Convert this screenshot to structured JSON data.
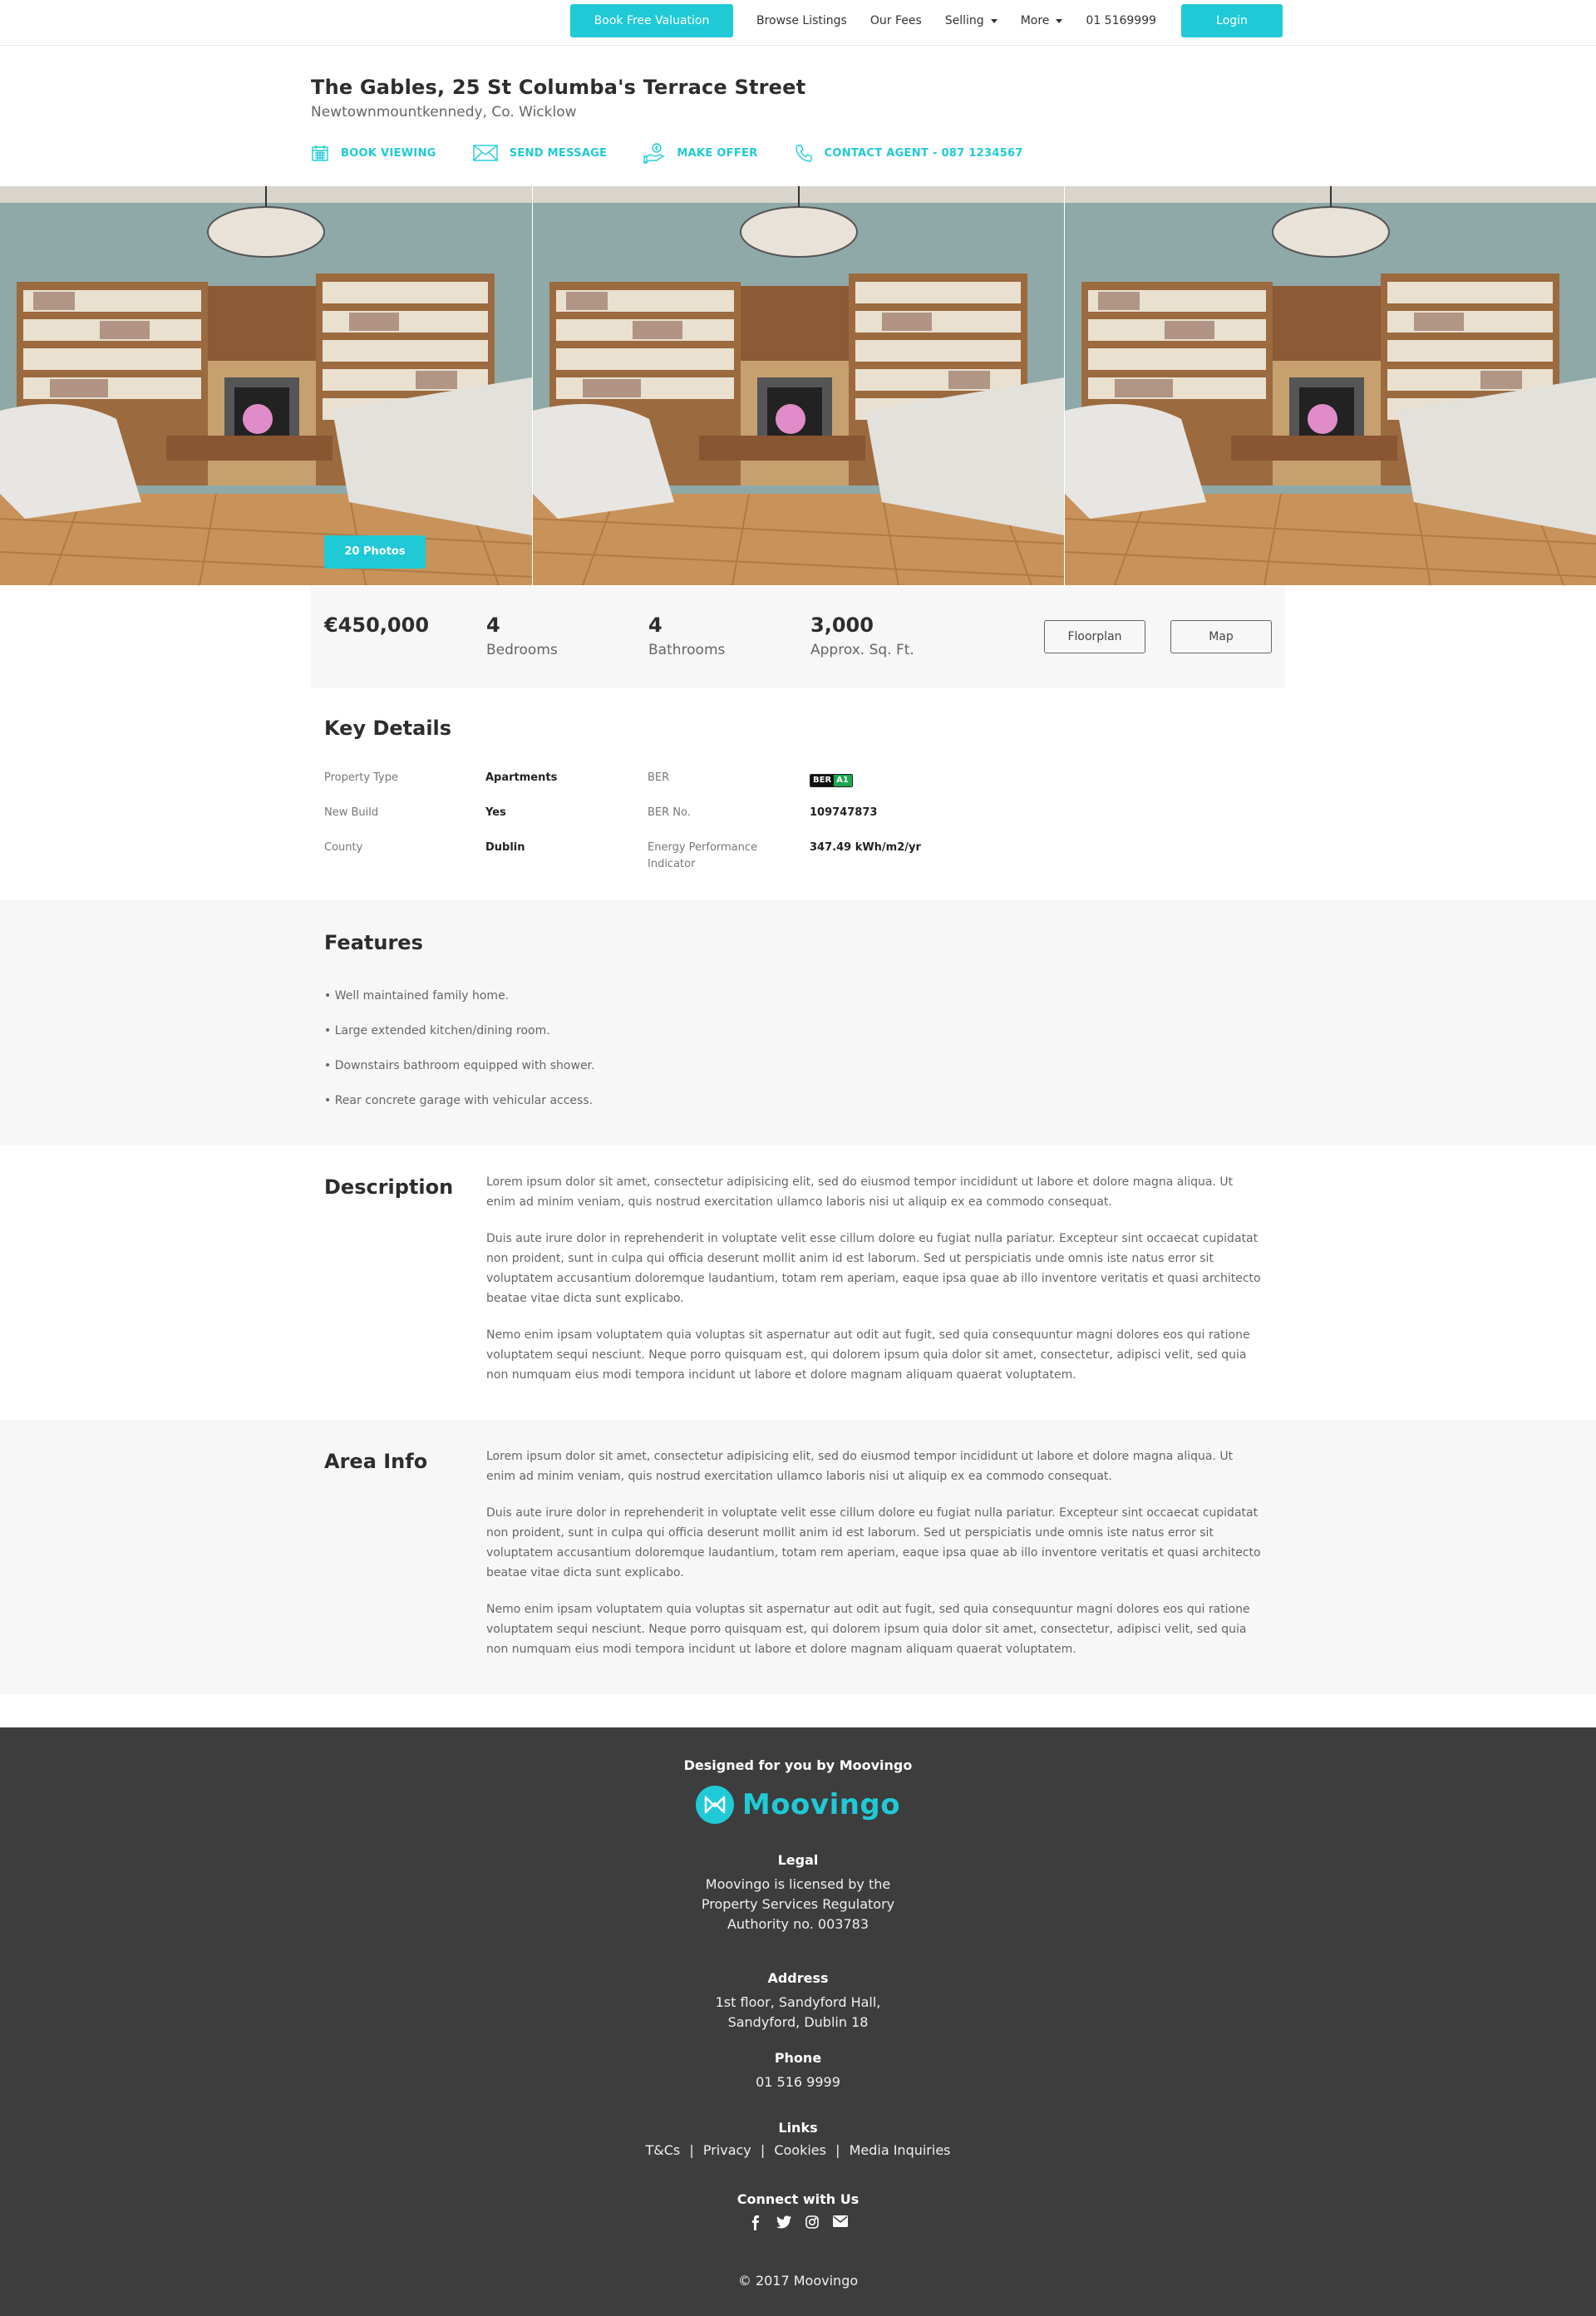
{
  "nav": {
    "cta": "Book Free Valuation",
    "browse": "Browse Listings",
    "fees": "Our Fees",
    "selling": "Selling",
    "more": "More",
    "phone": "01 5169999",
    "login": "Login"
  },
  "property": {
    "title": "The Gables, 25 St Columba's Terrace Street",
    "location": "Newtownmountkennedy, Co. Wicklow"
  },
  "actions": {
    "book": "BOOK VIEWING",
    "message": "SEND MESSAGE",
    "offer": "MAKE OFFER",
    "contact": "CONTACT AGENT - 087 1234567"
  },
  "gallery": {
    "photos_label": "20 Photos"
  },
  "stats": {
    "price": "€450,000",
    "bedrooms_value": "4",
    "bedrooms_label": "Bedrooms",
    "bathrooms_value": "4",
    "bathrooms_label": "Bathrooms",
    "area_value": "3,000",
    "area_label": "Approx. Sq. Ft.",
    "floorplan": "Floorplan",
    "map": "Map"
  },
  "key_details": {
    "title": "Key Details",
    "property_type_label": "Property Type",
    "property_type": "Apartments",
    "ber_label": "BER",
    "ber_badge_left": "BER",
    "ber_badge_right": "A1",
    "new_build_label": "New Build",
    "new_build": "Yes",
    "ber_no_label": "BER No.",
    "ber_no": "109747873",
    "county_label": "County",
    "county": "Dublin",
    "epi_label": "Energy Performance Indicator",
    "epi": "347.49 kWh/m2/yr"
  },
  "features": {
    "title": "Features",
    "items": [
      "• Well maintained family home.",
      "• Large extended kitchen/dining room.",
      "• Downstairs bathroom equipped with shower.",
      "• Rear concrete garage with vehicular access."
    ]
  },
  "description": {
    "title": "Description",
    "p1": "Lorem ipsum dolor sit amet, consectetur adipisicing elit, sed do eiusmod tempor incididunt ut labore et dolore magna aliqua. Ut enim ad minim veniam, quis nostrud exercitation ullamco laboris nisi ut aliquip ex ea commodo consequat.",
    "p2": "Duis aute irure dolor in reprehenderit in voluptate velit esse cillum dolore eu fugiat nulla pariatur. Excepteur sint occaecat cupidatat non proident, sunt in culpa qui officia deserunt mollit anim id est laborum. Sed ut perspiciatis unde omnis iste natus error sit voluptatem accusantium doloremque laudantium, totam rem aperiam, eaque ipsa quae ab illo inventore veritatis et quasi architecto beatae vitae dicta sunt explicabo.",
    "p3": "Nemo enim ipsam voluptatem quia voluptas sit aspernatur aut odit aut fugit, sed quia consequuntur magni dolores eos qui ratione voluptatem sequi nesciunt. Neque porro quisquam est, qui dolorem ipsum quia dolor sit amet, consectetur, adipisci velit, sed quia non numquam eius modi tempora incidunt ut labore et dolore magnam aliquam quaerat voluptatem."
  },
  "area_info": {
    "title": "Area Info",
    "p1": "Lorem ipsum dolor sit amet, consectetur adipisicing elit, sed do eiusmod tempor incididunt ut labore et dolore magna aliqua. Ut enim ad minim veniam, quis nostrud exercitation ullamco laboris nisi ut aliquip ex ea commodo consequat.",
    "p2": "Duis aute irure dolor in reprehenderit in voluptate velit esse cillum dolore eu fugiat nulla pariatur. Excepteur sint occaecat cupidatat non proident, sunt in culpa qui officia deserunt mollit anim id est laborum. Sed ut perspiciatis unde omnis iste natus error sit voluptatem accusantium doloremque laudantium, totam rem aperiam, eaque ipsa quae ab illo inventore veritatis et quasi architecto beatae vitae dicta sunt explicabo.",
    "p3": "Nemo enim ipsam voluptatem quia voluptas sit aspernatur aut odit aut fugit, sed quia consequuntur magni dolores eos qui ratione voluptatem sequi nesciunt. Neque porro quisquam est, qui dolorem ipsum quia dolor sit amet, consectetur, adipisci velit, sed quia non numquam eius modi tempora incidunt ut labore et dolore magnam aliquam quaerat voluptatem."
  },
  "footer": {
    "designed": "Designed for you by Moovingo",
    "logo_word": "Moovingo",
    "legal_title": "Legal",
    "legal_l1": "Moovingo is licensed by the",
    "legal_l2": "Property Services Regulatory",
    "legal_l3": "Authority no. 003783",
    "address_title": "Address",
    "address_l1": "1st floor, Sandyford Hall,",
    "address_l2": "Sandyford, Dublin 18",
    "phone_title": "Phone",
    "phone": "01 516 9999",
    "links_title": "Links",
    "link_tcs": "T&Cs",
    "link_privacy": "Privacy",
    "link_cookies": "Cookies",
    "link_media": "Media Inquiries",
    "link_sep": "|",
    "connect_title": "Connect with Us",
    "social_icons": [
      "facebook-icon",
      "twitter-icon",
      "instagram-icon",
      "email-icon"
    ],
    "copyright": "© 2017 Moovingo"
  },
  "colors": {
    "accent": "#1fcad6",
    "footer_bg": "#3d3d3d",
    "section_bg": "#f7f7f7",
    "ber_green": "#1aa84f"
  }
}
